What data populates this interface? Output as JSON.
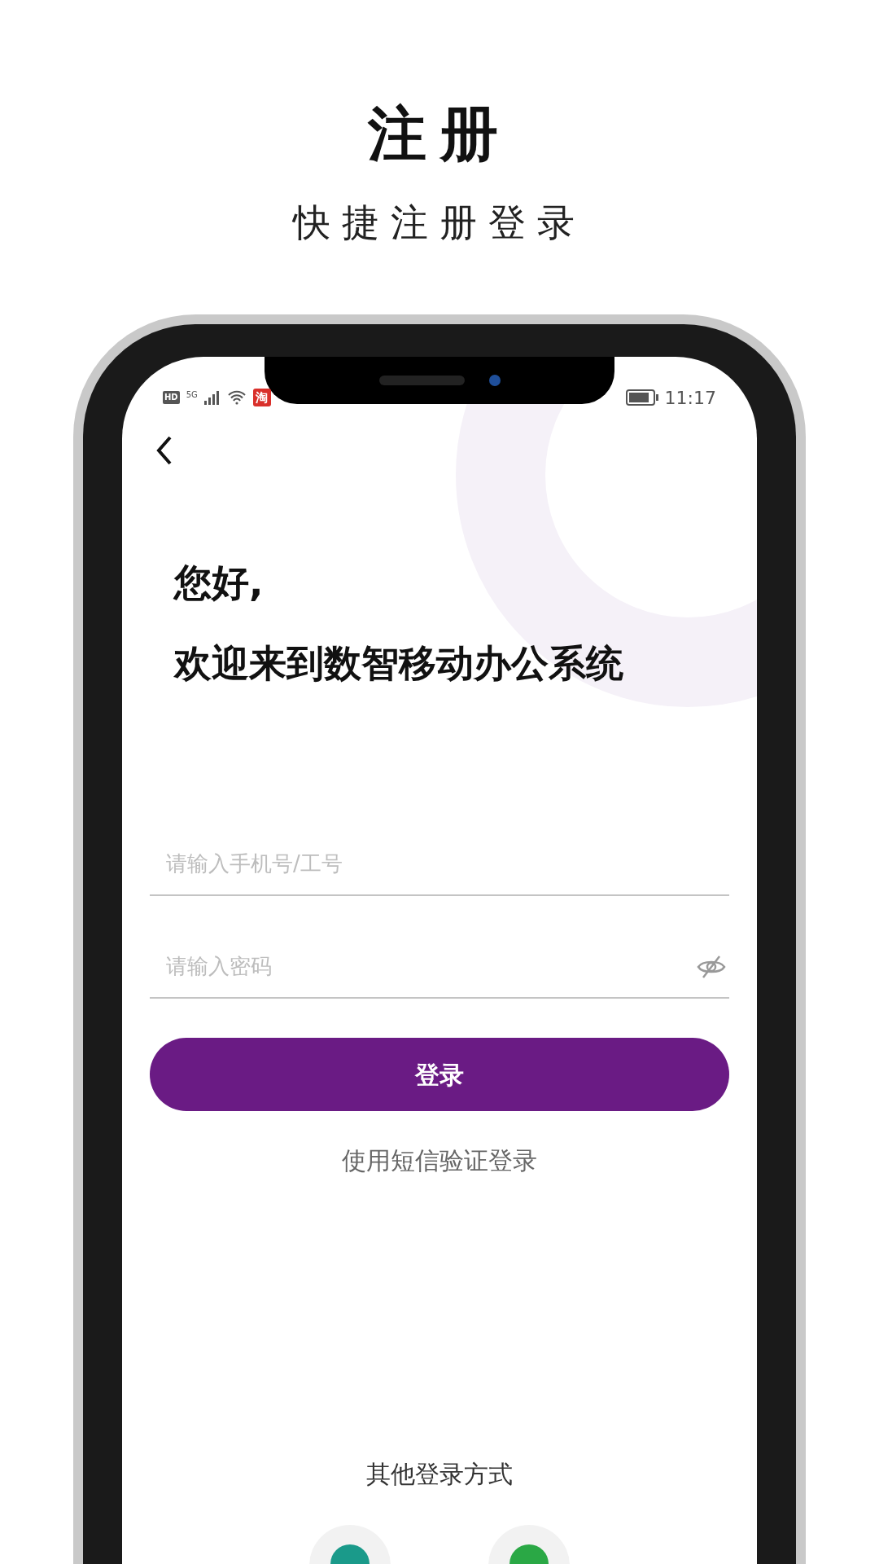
{
  "header": {
    "title": "注册",
    "subtitle": "快捷注册登录"
  },
  "status_bar": {
    "hd": "HD",
    "network": "5G",
    "app_badge": "淘",
    "time": "11:17"
  },
  "greeting": [
    "您好,",
    "欢迎来到数智移动办公系统"
  ],
  "fields": [
    {
      "placeholder": "请输入手机号/工号",
      "kind": "text"
    },
    {
      "placeholder": "请输入密码",
      "kind": "password"
    }
  ],
  "login_button": "登录",
  "sms_link": "使用短信验证登录",
  "other_login": {
    "label": "其他登录方式",
    "options": [
      {
        "color": "#1a9a8a"
      },
      {
        "color": "#2aa845"
      }
    ]
  }
}
